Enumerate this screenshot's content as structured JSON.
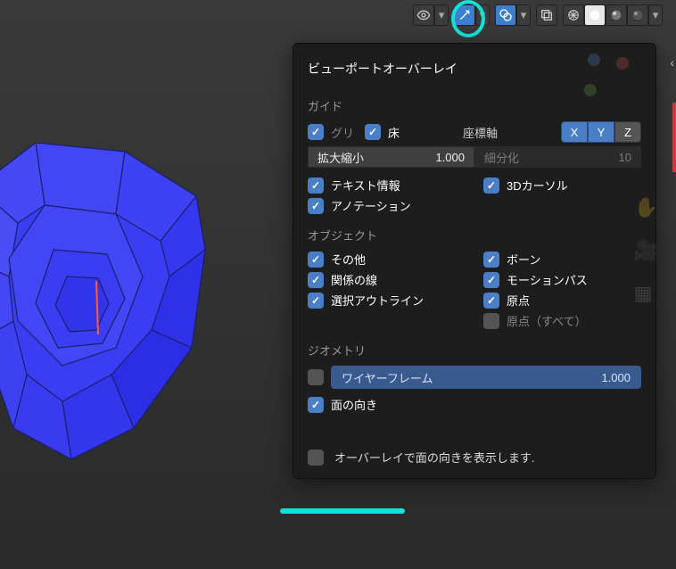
{
  "toolbar": {
    "eye": "visibility-dropdown",
    "gizmo_btn": "gizmo-toggle",
    "overlay_btn": "overlay-toggle",
    "toggle_xray": "toggle-xray",
    "shading_wire": "wireframe-shading",
    "shading_solid": "solid-shading",
    "shading_mat": "material-shading",
    "shading_render": "render-shading"
  },
  "popover": {
    "title": "ビューポートオーバーレイ",
    "guides": {
      "label": "ガイド",
      "grid": "グリ",
      "floor": "床",
      "axes_label": "座標軸",
      "axes": [
        "X",
        "Y",
        "Z"
      ],
      "scale_label": "拡大縮小",
      "scale_value": "1.000",
      "subdiv_label": "細分化",
      "subdiv_value": "10",
      "text_info": "テキスト情報",
      "cursor": "3Dカーソル",
      "annotations": "アノテーション"
    },
    "objects": {
      "label": "オブジェクト",
      "extras": "その他",
      "bones": "ボーン",
      "relation": "関係の線",
      "motion": "モーションパス",
      "outline": "選択アウトライン",
      "origin": "原点",
      "origin_all": "原点（すべて）"
    },
    "geometry": {
      "label": "ジオメトリ",
      "wireframe": "ワイヤーフレーム",
      "wire_value": "1.000",
      "face_orient": "面の向き"
    },
    "tooltip": "オーバーレイで面の向きを表示します."
  }
}
